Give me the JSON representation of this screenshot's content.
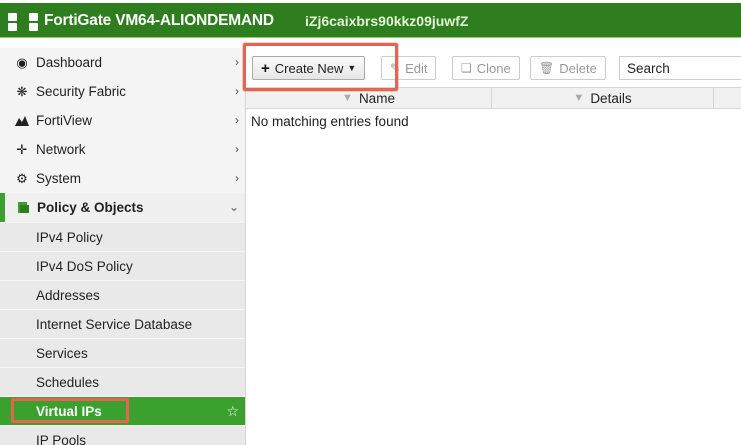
{
  "header": {
    "app_title": "FortiGate VM64-ALIONDEMAND",
    "serial": "iZj6caixbrs90kkz09juwfZ",
    "logo_icon": "fortinet-logo-icon"
  },
  "colors": {
    "brand_green": "#2e7d1e",
    "active_green": "#3aa12f",
    "highlight": "#e4644f"
  },
  "sidebar": {
    "items": [
      {
        "label": "Dashboard",
        "icon": "dashboard-icon"
      },
      {
        "label": "Security Fabric",
        "icon": "security-fabric-icon"
      },
      {
        "label": "FortiView",
        "icon": "fortiview-icon"
      },
      {
        "label": "Network",
        "icon": "network-icon"
      },
      {
        "label": "System",
        "icon": "gear-icon"
      },
      {
        "label": "Policy & Objects",
        "icon": "policy-icon"
      }
    ],
    "sub_items": [
      {
        "label": "IPv4 Policy"
      },
      {
        "label": "IPv4 DoS Policy"
      },
      {
        "label": "Addresses"
      },
      {
        "label": "Internet Service Database"
      },
      {
        "label": "Services"
      },
      {
        "label": "Schedules"
      },
      {
        "label": "Virtual IPs"
      },
      {
        "label": "IP Pools"
      }
    ]
  },
  "toolbar": {
    "create_label": "Create New",
    "edit_label": "Edit",
    "clone_label": "Clone",
    "delete_label": "Delete",
    "search_placeholder": "Search"
  },
  "table": {
    "columns": [
      "Name",
      "Details"
    ],
    "empty_text": "No matching entries found"
  }
}
